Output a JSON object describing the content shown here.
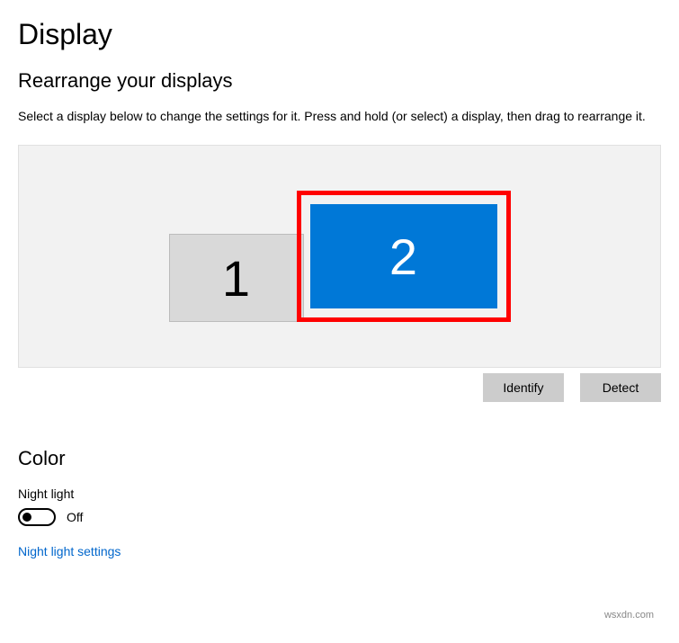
{
  "page": {
    "title": "Display"
  },
  "rearrange": {
    "heading": "Rearrange your displays",
    "description": "Select a display below to change the settings for it. Press and hold (or select) a display, then drag to rearrange it.",
    "displays": {
      "d1": "1",
      "d2": "2"
    },
    "buttons": {
      "identify": "Identify",
      "detect": "Detect"
    }
  },
  "color": {
    "heading": "Color",
    "night_light_label": "Night light",
    "night_light_state": "Off",
    "night_light_link": "Night light settings"
  },
  "watermark": "wsxdn.com"
}
